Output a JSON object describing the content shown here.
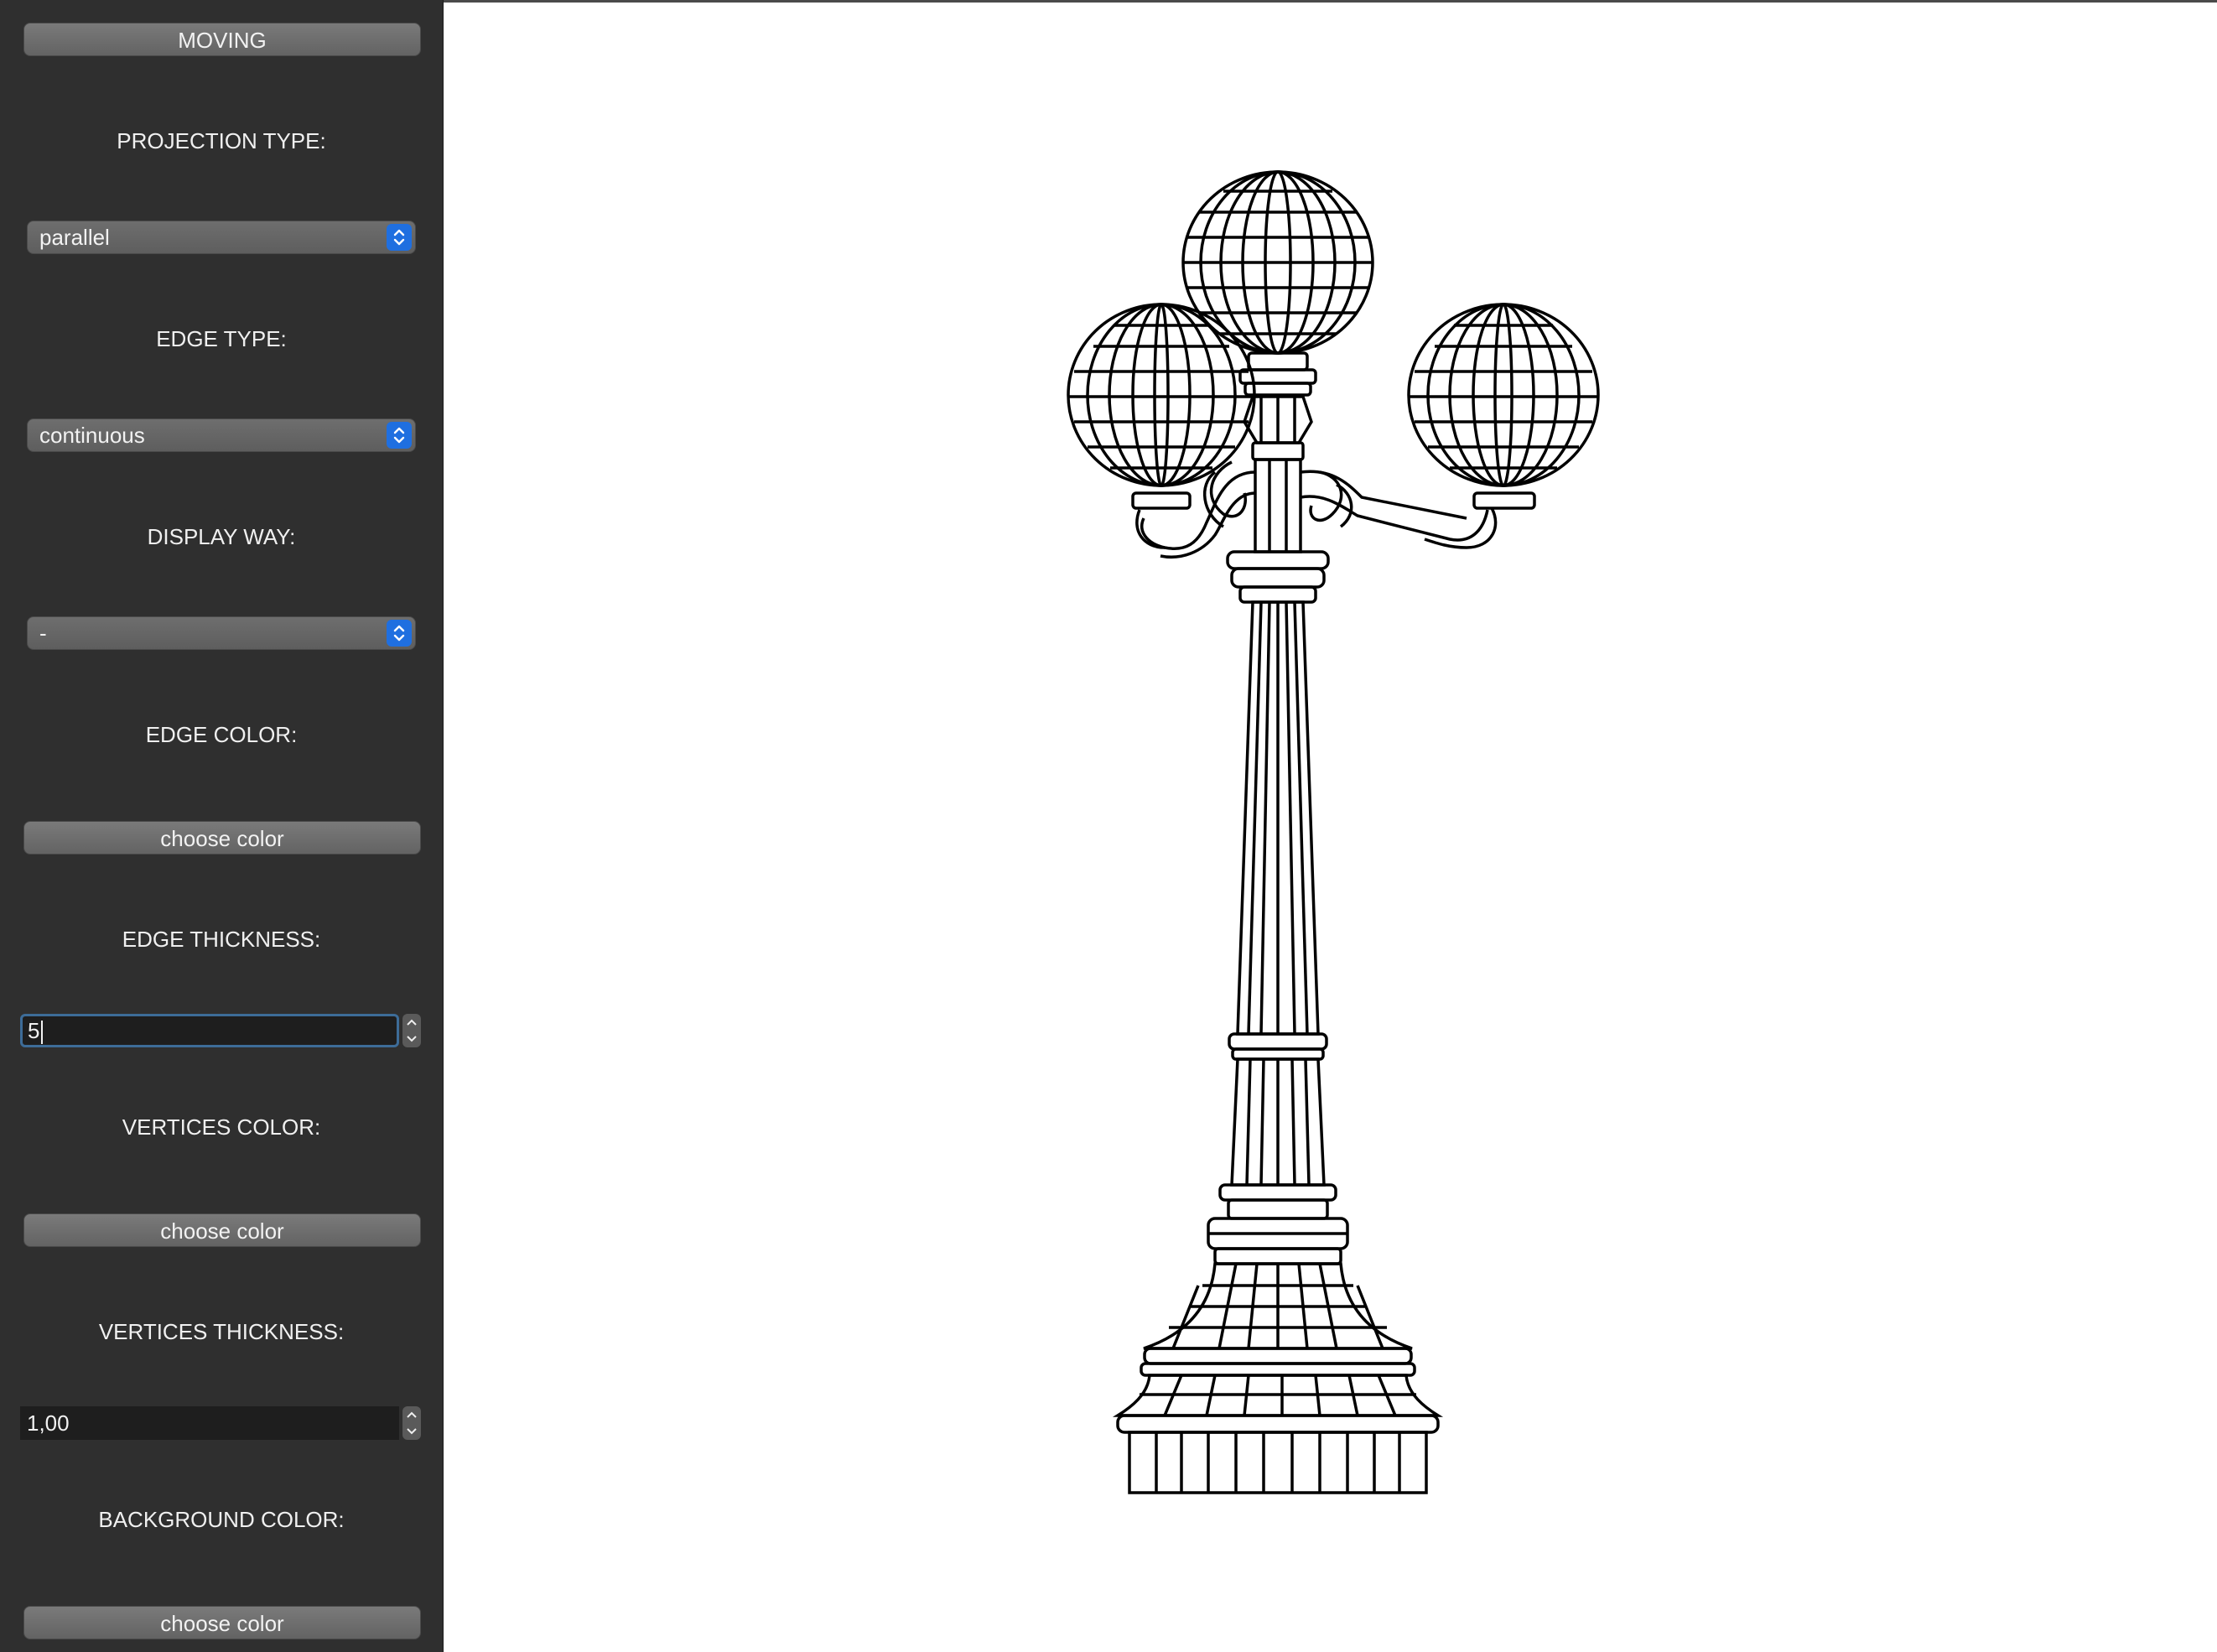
{
  "sidebar": {
    "moving_button": "MOVING",
    "projection_type_label": "PROJECTION TYPE:",
    "projection_type_value": "parallel",
    "edge_type_label": "EDGE  TYPE:",
    "edge_type_value": "continuous",
    "display_way_label": "DISPLAY WAY:",
    "display_way_value": "-",
    "edge_color_label": "EDGE COLOR:",
    "edge_color_button": "choose color",
    "edge_thickness_label": "EDGE THICKNESS:",
    "edge_thickness_value": "5",
    "vertices_color_label": "VERTICES  COLOR:",
    "vertices_color_button": "choose color",
    "vertices_thickness_label": "VERTICES THICKNESS:",
    "vertices_thickness_value": "1,00",
    "background_color_label": "BACKGROUND COLOR:",
    "background_color_button": "choose color"
  },
  "viewport": {
    "model": "street-lamp-wireframe-icon",
    "edge_color": "#000000",
    "background_color": "#ffffff"
  },
  "colors": {
    "sidebar_bg": "#2f2f2f",
    "accent": "#1f6fe0",
    "focus_ring": "#3d6c98"
  }
}
